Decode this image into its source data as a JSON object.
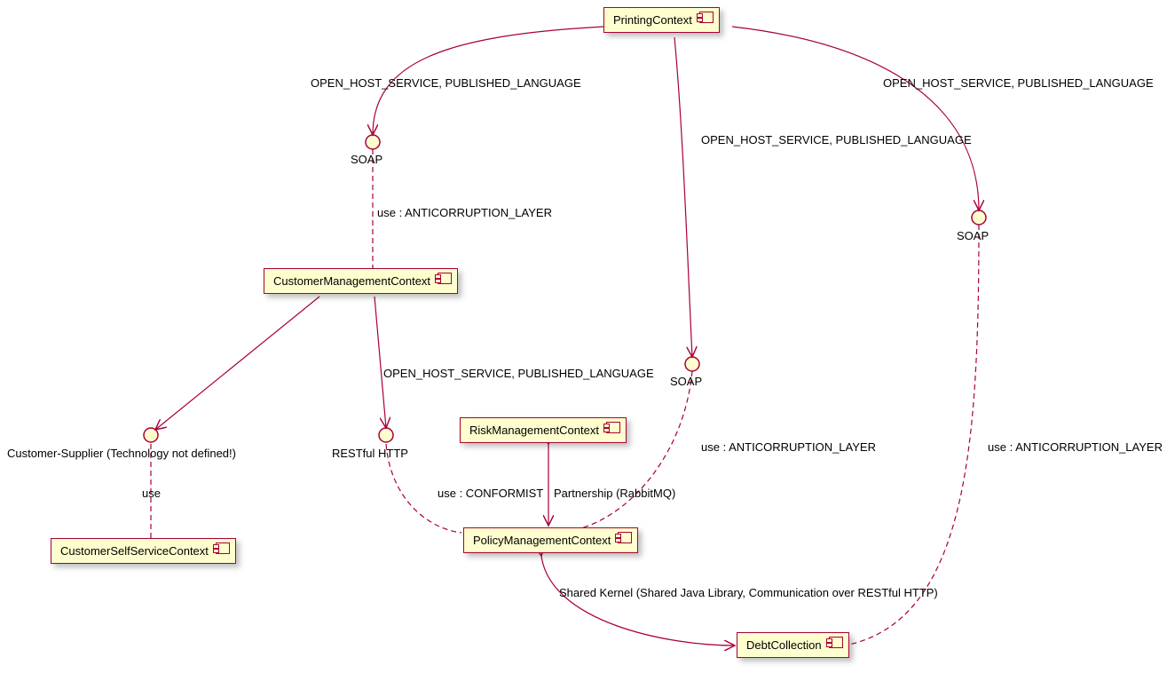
{
  "components": {
    "printing": {
      "label": "PrintingContext"
    },
    "cmc": {
      "label": "CustomerManagementContext"
    },
    "risk": {
      "label": "RiskManagementContext"
    },
    "css": {
      "label": "CustomerSelfServiceContext"
    },
    "policy": {
      "label": "PolicyManagementContext"
    },
    "debt": {
      "label": "DebtCollection"
    }
  },
  "interfaces": {
    "soap_left": "SOAP",
    "soap_mid": "SOAP",
    "soap_right": "SOAP",
    "restful": "RESTful HTTP",
    "cust_supp": "Customer-Supplier (Technology not defined!)"
  },
  "relations": {
    "ohs_pl_1": "OPEN_HOST_SERVICE, PUBLISHED_LANGUAGE",
    "ohs_pl_2": "OPEN_HOST_SERVICE, PUBLISHED_LANGUAGE",
    "ohs_pl_3": "OPEN_HOST_SERVICE, PUBLISHED_LANGUAGE",
    "ohs_pl_4": "OPEN_HOST_SERVICE, PUBLISHED_LANGUAGE",
    "acl_1": "use : ANTICORRUPTION_LAYER",
    "acl_2": "use : ANTICORRUPTION_LAYER",
    "acl_3": "use : ANTICORRUPTION_LAYER",
    "conformist": "use : CONFORMIST",
    "partnership": "Partnership (RabbitMQ)",
    "use_simple": "use",
    "shared_kernel": "Shared Kernel (Shared Java Library, Communication over RESTful HTTP)"
  }
}
